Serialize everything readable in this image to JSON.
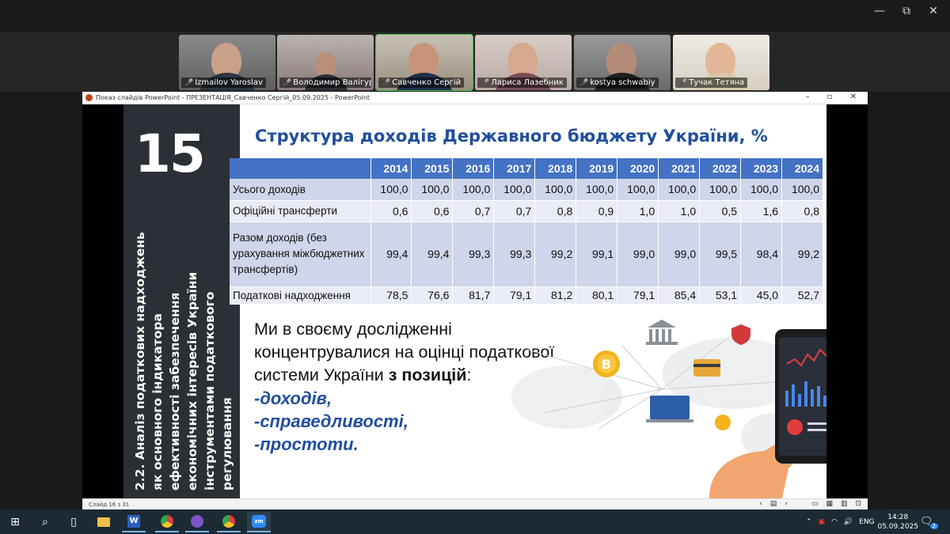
{
  "window_controls": {
    "minimize": "—",
    "restore": "⧉",
    "close": "✕"
  },
  "participants": [
    {
      "name": "Izmailov Yaroslav",
      "muted": true
    },
    {
      "name": "Володимир Валігура",
      "muted": true
    },
    {
      "name": "Савченко Сергій",
      "muted": true,
      "active": true
    },
    {
      "name": "Лариса Лазебник",
      "muted": true
    },
    {
      "name": "kostya schwabiy",
      "muted": true
    },
    {
      "name": "Тучак Тетяна",
      "muted": true
    }
  ],
  "ppt": {
    "titlebar": "Показ слайдів PowerPoint  -  ПРЕЗЕНТАЦІЯ_Савченко Сергій_05.09.2025  -  PowerPoint",
    "status_left": "Слайд 16 з 31"
  },
  "slide": {
    "number": "15",
    "vertical_text": "2.2. Аналіз податкових надходжень як основного індикатора ефективності забезпечення економічних інтересів України інструментами податкового регулювання",
    "title": "Структура доходів Державного бюджету України, %",
    "table": {
      "columns": [
        "2014",
        "2015",
        "2016",
        "2017",
        "2018",
        "2019",
        "2020",
        "2021",
        "2022",
        "2023",
        "2024"
      ],
      "rows": [
        {
          "label": "Усього доходів",
          "values": [
            "100,0",
            "100,0",
            "100,0",
            "100,0",
            "100,0",
            "100,0",
            "100,0",
            "100,0",
            "100,0",
            "100,0",
            "100,0"
          ]
        },
        {
          "label": "Офіційні трансферти",
          "values": [
            "0,6",
            "0,6",
            "0,7",
            "0,7",
            "0,8",
            "0,9",
            "1,0",
            "1,0",
            "0,5",
            "1,6",
            "0,8"
          ]
        },
        {
          "label": "Разом доходів (без урахування міжбюджетних трансфертів)",
          "values": [
            "99,4",
            "99,4",
            "99,3",
            "99,3",
            "99,2",
            "99,1",
            "99,0",
            "99,0",
            "99,5",
            "98,4",
            "99,2"
          ]
        },
        {
          "label": "Податкові надходження",
          "values": [
            "78,5",
            "76,6",
            "81,7",
            "79,1",
            "81,2",
            "80,1",
            "79,1",
            "85,4",
            "53,1",
            "45,0",
            "52,7"
          ]
        }
      ]
    },
    "body_intro": "Ми в своєму дослідженні концентрувалися на оцінці податкової системи України ",
    "body_bold": "з позицій",
    "body_colon": ":",
    "list": [
      "-доходів,",
      "-справедливості,",
      "-простоти."
    ]
  },
  "taskbar": {
    "language": "ENG",
    "time": "14:28",
    "date": "05.09.2025",
    "notification_count": "2",
    "apps": [
      "windows-start-icon",
      "search-icon",
      "task-view-icon",
      "file-explorer-icon",
      "word-icon",
      "chrome-icon",
      "viber-icon",
      "chrome-icon",
      "zoom-icon"
    ]
  },
  "colors": {
    "title_blue": "#1f4e9d",
    "table_header": "#4472c4",
    "left_panel": "#2b2f36",
    "active_speaker": "#35c84a"
  }
}
